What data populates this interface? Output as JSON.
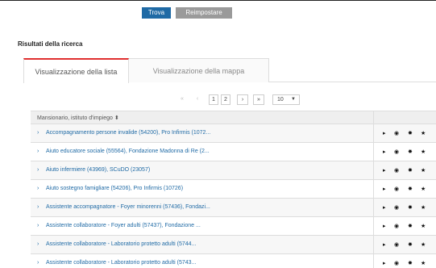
{
  "search": {
    "find_label": "Trova",
    "reset_label": "Reimpostare"
  },
  "results": {
    "title": "Risultati della ricerca"
  },
  "tabs": [
    {
      "label": "Visualizzazione della lista",
      "active": true
    },
    {
      "label": "Visualizzazione della mappa",
      "active": false
    }
  ],
  "pager": {
    "first": "«",
    "prev": "‹",
    "pages": [
      "1",
      "2"
    ],
    "next": "›",
    "last": "»",
    "per_page": "10"
  },
  "table": {
    "header": "Mansionario, istituto d'impiego ⬍",
    "rows": [
      {
        "text": "Accompagnamento persone invalide (54200), Pro Infirmis (1072..."
      },
      {
        "text": "Aiuto educatore sociale (55564), Fondazione Madonna di Re (2..."
      },
      {
        "text": "Aiuto infermiere (43969), SCuDO (23057)"
      },
      {
        "text": "Aiuto sostegno famigliare (54206), Pro Infirmis (10726)"
      },
      {
        "text": "Assistente accompagnatore - Foyer minorenni (57436), Fondazi..."
      },
      {
        "text": "Assistente collaboratore - Foyer adulti (57437), Fondazione ..."
      },
      {
        "text": "Assistente collaboratore - Laboratorio protetto adulti (5744..."
      },
      {
        "text": "Assistente collaboratore - Laboratorio protetto adulti (5743..."
      }
    ]
  },
  "icons": {
    "chevron": "›",
    "expand": "▸",
    "view": "◉",
    "sun": "✸",
    "star": "★"
  },
  "colors": {
    "primary": "#1f6aa5",
    "accent_tab": "#e03030",
    "reset": "#9a9a9a"
  }
}
